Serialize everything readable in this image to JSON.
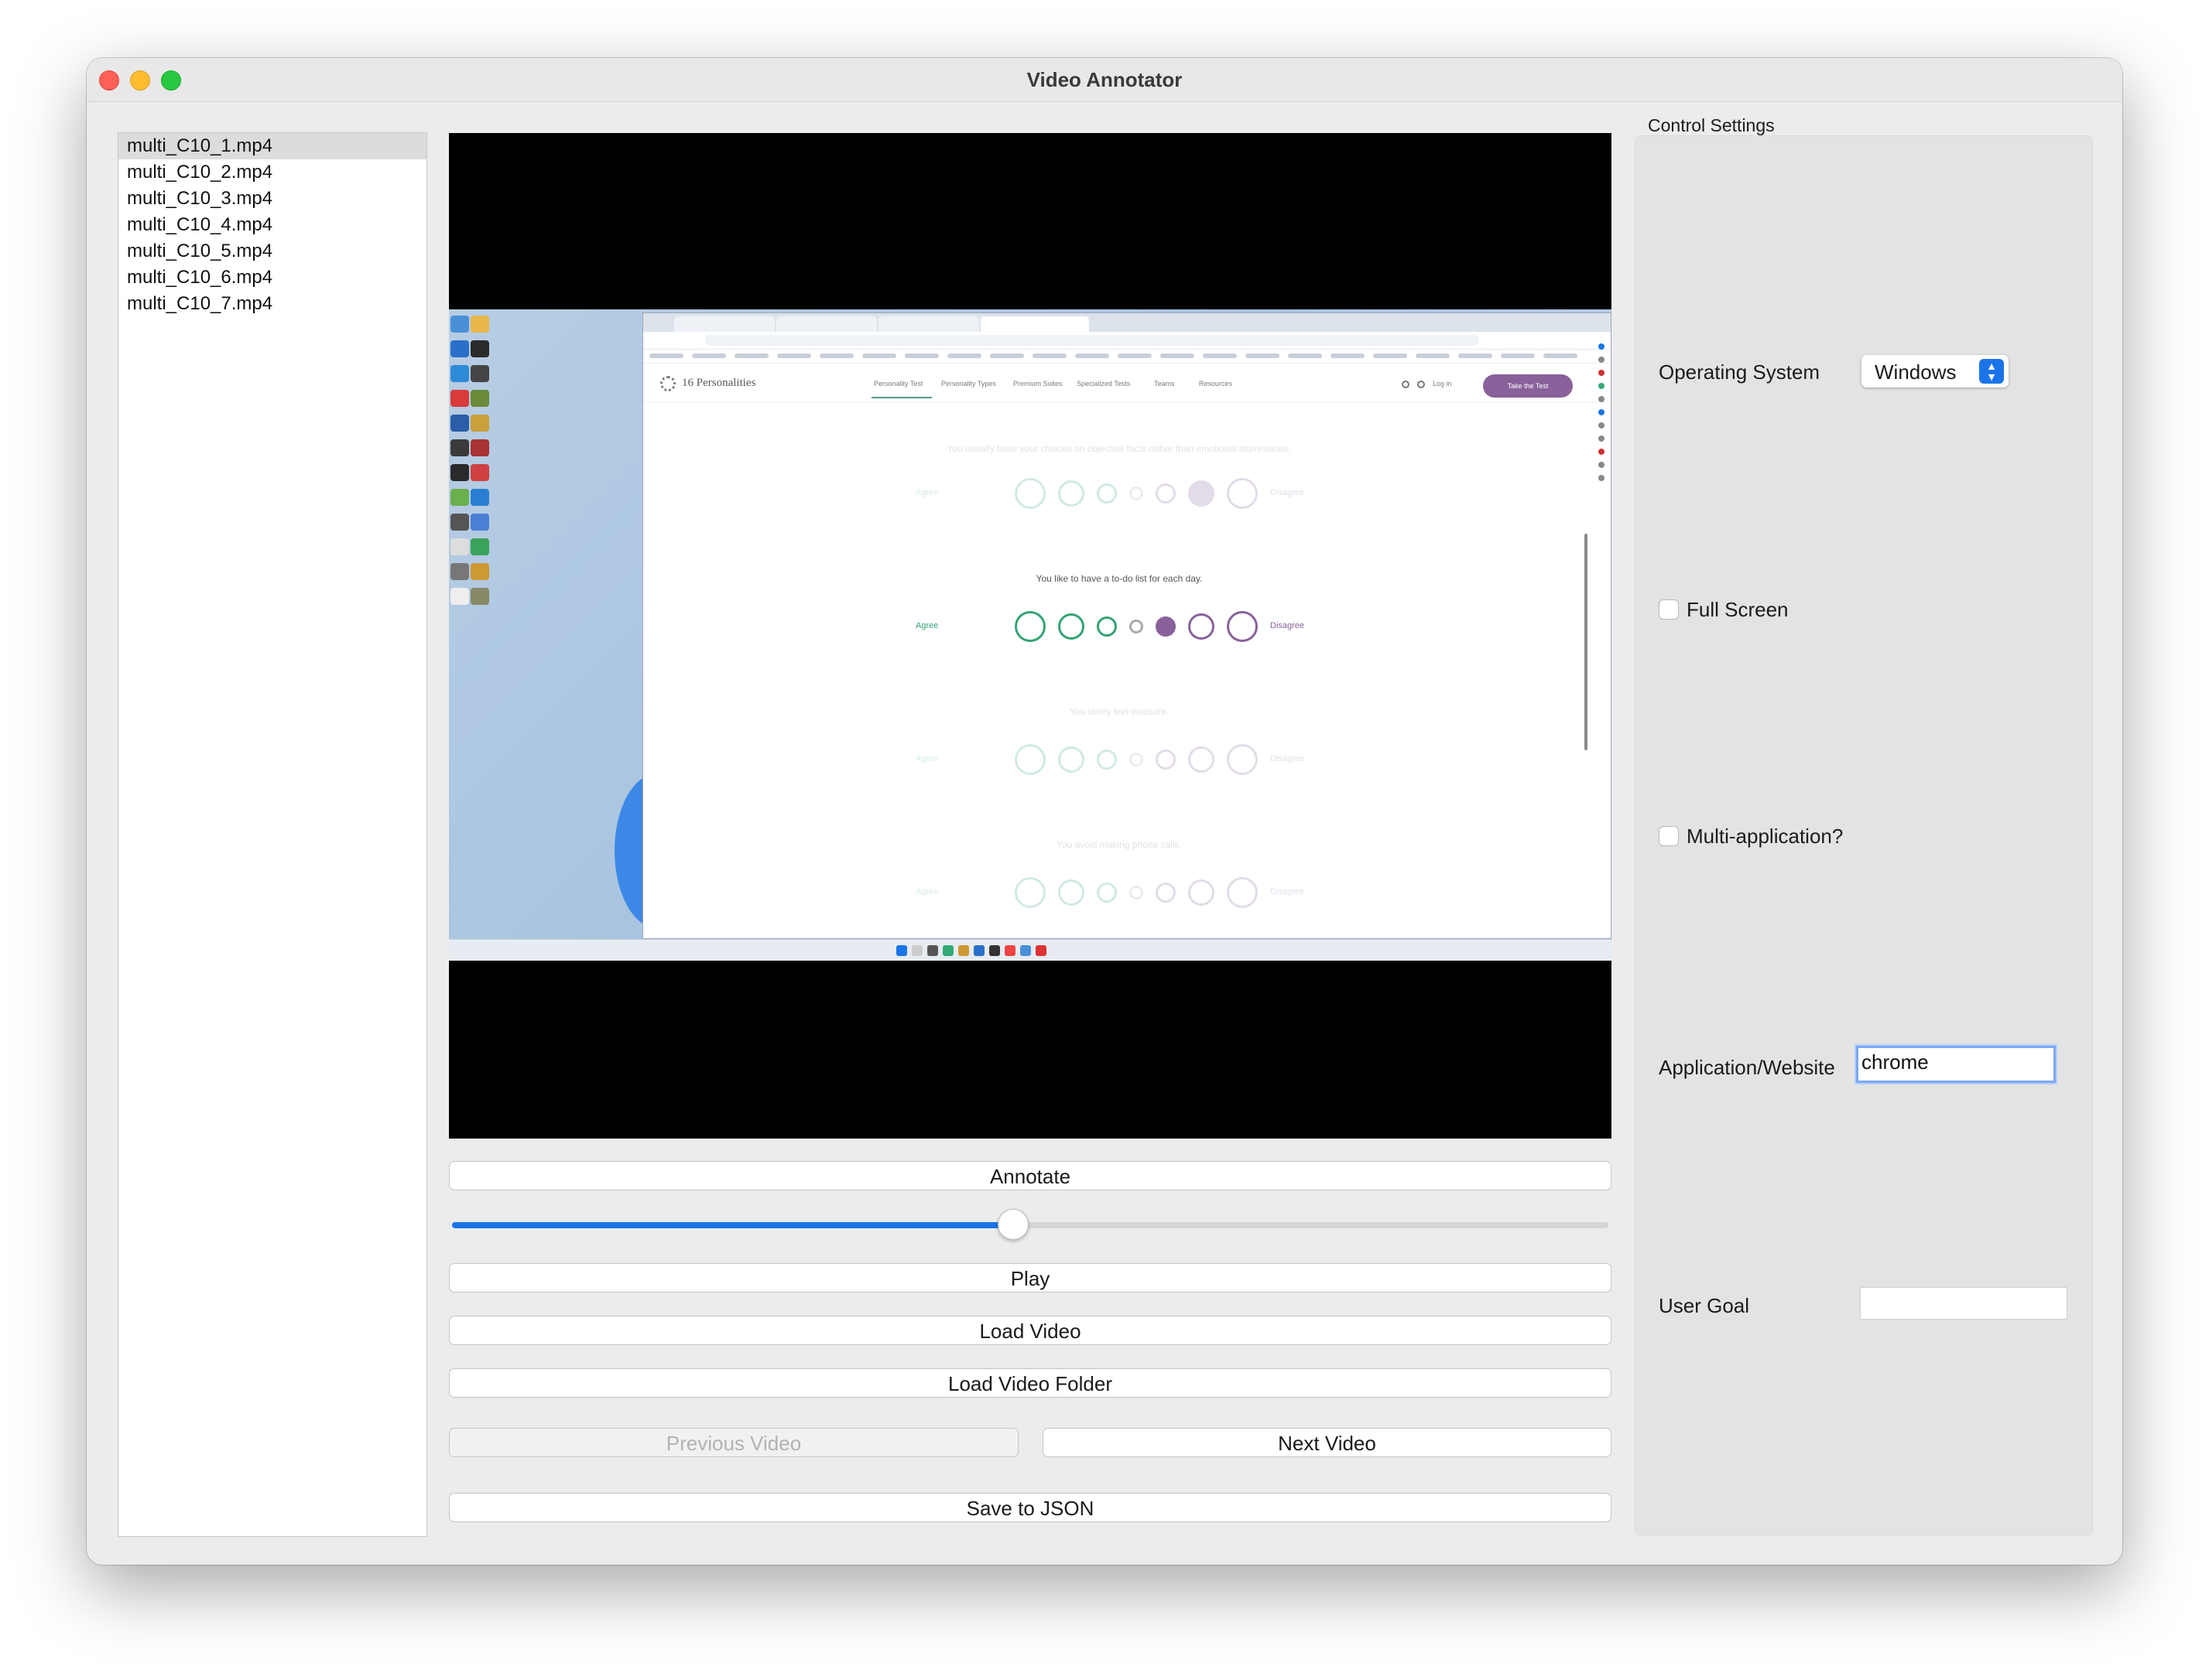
{
  "window": {
    "title": "Video Annotator",
    "traffic_lights": [
      "close",
      "minimize",
      "zoom"
    ]
  },
  "file_list": {
    "selected_index": 0,
    "items": [
      "multi_C10_1.mp4",
      "multi_C10_2.mp4",
      "multi_C10_3.mp4",
      "multi_C10_4.mp4",
      "multi_C10_5.mp4",
      "multi_C10_6.mp4",
      "multi_C10_7.mp4"
    ]
  },
  "video_frame": {
    "site_logo": "16 Personalities",
    "nav_items": [
      "Personality Test",
      "Personality Types",
      "Premium Suites",
      "Specialized Tests",
      "Teams",
      "Resources"
    ],
    "login": "Log in",
    "cta": "Take the Test",
    "questions": [
      "You usually base your choices on objective facts rather than emotional impressions.",
      "You like to have a to-do list for each day.",
      "You rarely feel insecure.",
      "You avoid making phone calls."
    ],
    "agree_label": "Agree",
    "disagree_label": "Disagree"
  },
  "controls": {
    "annotate_label": "Annotate",
    "slider_value": 0.485,
    "play_label": "Play",
    "load_video_label": "Load Video",
    "load_folder_label": "Load Video Folder",
    "previous_label": "Previous Video",
    "next_label": "Next Video",
    "save_label": "Save to JSON"
  },
  "settings": {
    "title": "Control Settings",
    "os_label": "Operating System",
    "os_value": "Windows",
    "full_screen_label": "Full Screen",
    "full_screen_checked": false,
    "multi_app_label": "Multi-application?",
    "multi_app_checked": false,
    "app_label": "Application/Website",
    "app_value": "chrome",
    "goal_label": "User Goal",
    "goal_value": ""
  },
  "colors": {
    "accent": "#1a74e8",
    "agree": "#33a474",
    "disagree": "#88619a"
  }
}
